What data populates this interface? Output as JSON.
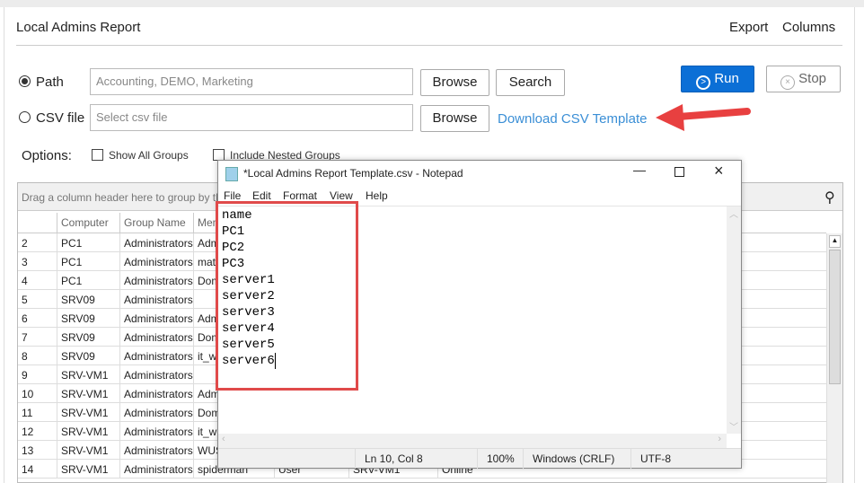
{
  "header": {
    "title": "Local Admins Report",
    "export": "Export",
    "columns": "Columns"
  },
  "inputs": {
    "path_label": "Path",
    "path_placeholder": "Accounting, DEMO, Marketing",
    "csv_label": "CSV file",
    "csv_placeholder": "Select csv file",
    "browse": "Browse",
    "search": "Search",
    "download_template": "Download CSV Template",
    "run": "Run",
    "stop": "Stop",
    "selected": "Path"
  },
  "options": {
    "label": "Options:",
    "show_all_groups": "Show All Groups",
    "include_nested": "Include Nested Groups"
  },
  "grid": {
    "group_hint": "Drag a column header here to group by that column",
    "columns": [
      "Computer",
      "Group Name",
      "Mem"
    ],
    "rows": [
      [
        "2",
        "PC1",
        "Administrators",
        "Adm"
      ],
      [
        "3",
        "PC1",
        "Administrators",
        "math"
      ],
      [
        "4",
        "PC1",
        "Administrators",
        "Dom"
      ],
      [
        "5",
        "SRV09",
        "Administrators",
        ""
      ],
      [
        "6",
        "SRV09",
        "Administrators",
        "Adm"
      ],
      [
        "7",
        "SRV09",
        "Administrators",
        "Dom"
      ],
      [
        "8",
        "SRV09",
        "Administrators",
        "it_w"
      ],
      [
        "9",
        "SRV-VM1",
        "Administrators",
        ""
      ],
      [
        "10",
        "SRV-VM1",
        "Administrators",
        "Adm"
      ],
      [
        "11",
        "SRV-VM1",
        "Administrators",
        "Dom"
      ],
      [
        "12",
        "SRV-VM1",
        "Administrators",
        "it_w"
      ],
      [
        "13",
        "SRV-VM1",
        "Administrators",
        "WUS"
      ],
      [
        "14",
        "SRV-VM1",
        "Administrators",
        "spiderman",
        "User",
        "SRV-VM1",
        "Online"
      ]
    ]
  },
  "notepad": {
    "title": "*Local Admins Report Template.csv - Notepad",
    "menu": [
      "File",
      "Edit",
      "Format",
      "View",
      "Help"
    ],
    "lines": [
      "name",
      "PC1",
      "PC2",
      "PC3",
      "server1",
      "server2",
      "server3",
      "server4",
      "server5",
      "server6"
    ],
    "status": {
      "position": "Ln 10, Col 8",
      "zoom": "100%",
      "line_ending": "Windows (CRLF)",
      "encoding": "UTF-8"
    }
  },
  "colors": {
    "run_button": "#0b6fd6",
    "link": "#3b8fd6",
    "highlight": "#e04a4a"
  }
}
